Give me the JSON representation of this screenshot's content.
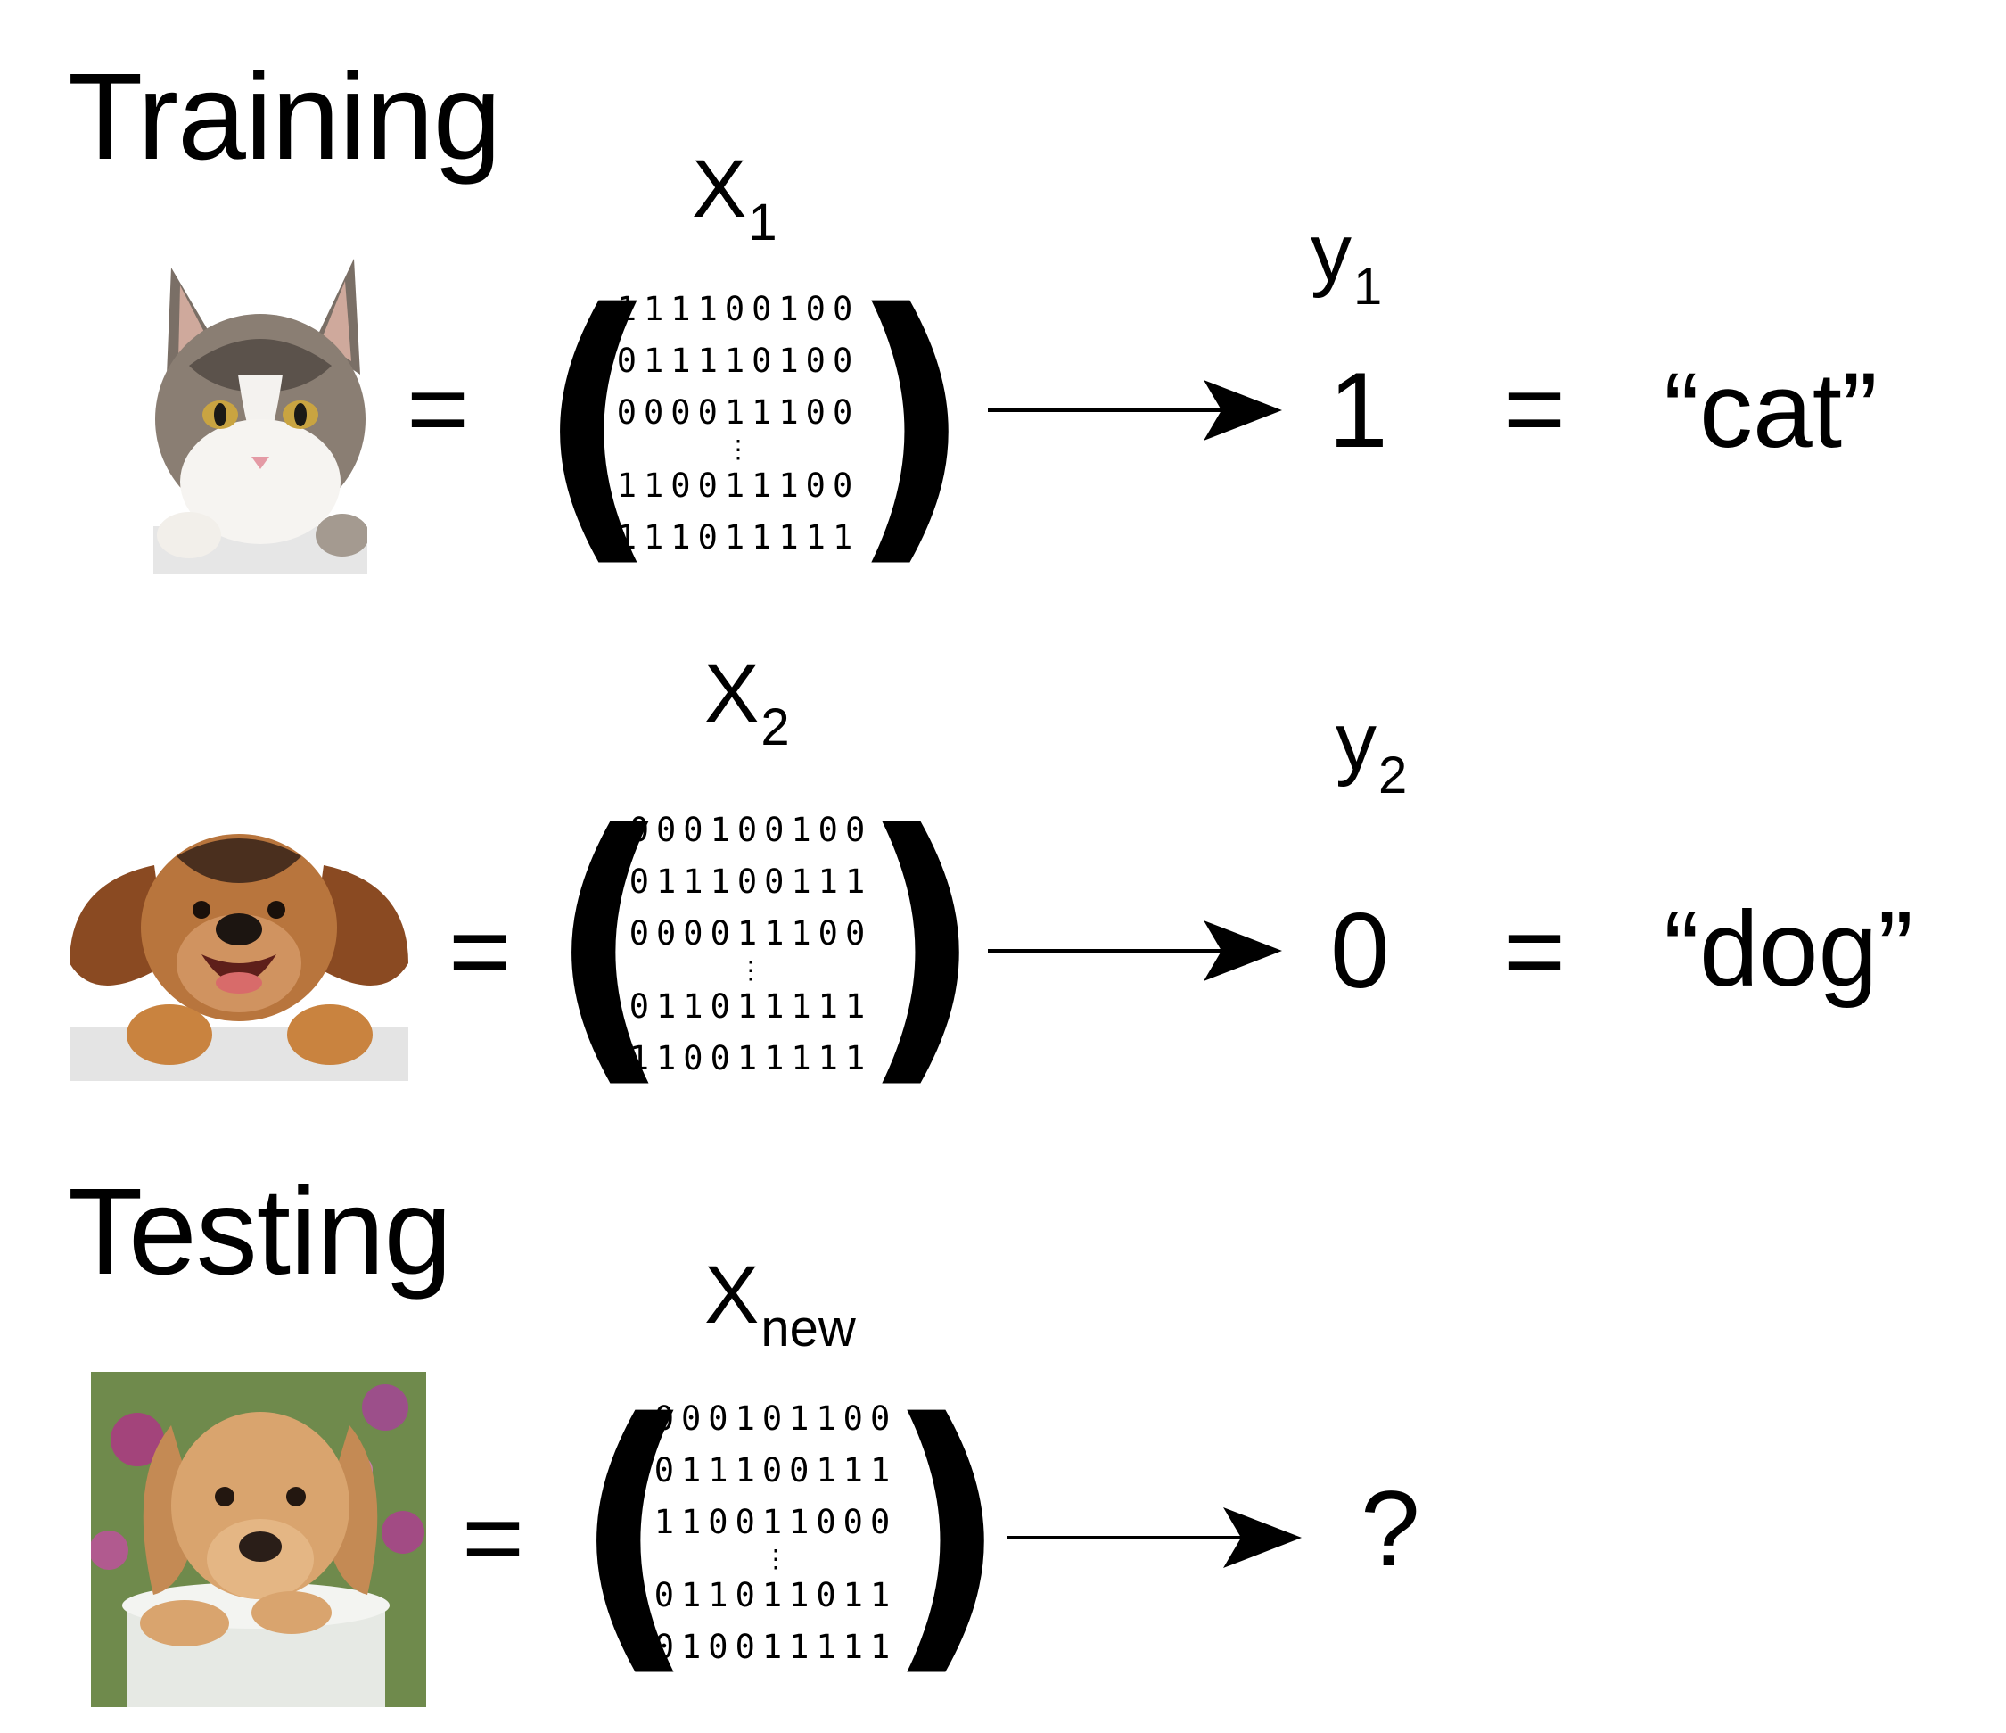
{
  "training": {
    "title": "Training",
    "examples": [
      {
        "animal": "cat",
        "x_label": "X",
        "x_sub": "1",
        "equals": "=",
        "matrix_rows": [
          "111100100",
          "011110100",
          "000011100",
          "110011100",
          "111011111"
        ],
        "ellipsis": "⋮",
        "y_label": "y",
        "y_sub": "1",
        "y_value": "1",
        "equals2": "=",
        "class_name": "“cat”"
      },
      {
        "animal": "dog",
        "x_label": "X",
        "x_sub": "2",
        "equals": "=",
        "matrix_rows": [
          "000100100",
          "011100111",
          "000011100",
          "011011111",
          "110011111"
        ],
        "ellipsis": "⋮",
        "y_label": "y",
        "y_sub": "2",
        "y_value": "0",
        "equals2": "=",
        "class_name": "“dog”"
      }
    ]
  },
  "testing": {
    "title": "Testing",
    "example": {
      "animal": "puppy",
      "x_label": "X",
      "x_sub": "new",
      "equals": "=",
      "matrix_rows": [
        "000101100",
        "011100111",
        "110011000",
        "011011011",
        "010011111"
      ],
      "ellipsis": "⋮",
      "result": "?"
    }
  },
  "brackets": {
    "left": "(",
    "right": ")"
  }
}
